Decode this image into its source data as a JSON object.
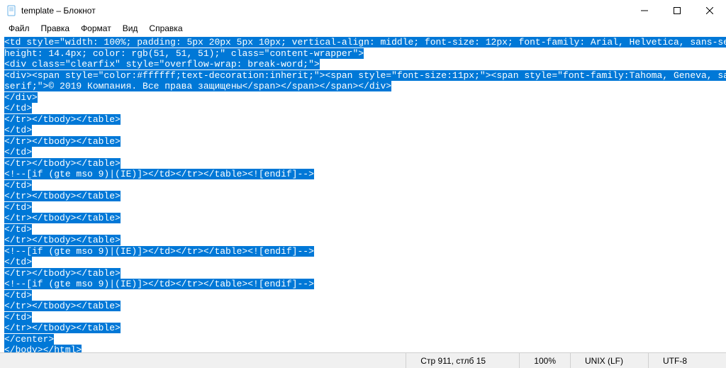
{
  "title": "template – Блокнот",
  "menu": {
    "file": "Файл",
    "edit": "Правка",
    "format": "Формат",
    "view": "Вид",
    "help": "Справка"
  },
  "content_lines": [
    "<td style=\"width: 100%; padding: 5px 20px 5px 10px; vertical-align: middle; font-size: 12px; font-family: Arial, Helvetica, sans-serif; line-",
    "height: 14.4px; color: rgb(51, 51, 51);\" class=\"content-wrapper\">",
    "<div class=\"clearfix\" style=\"overflow-wrap: break-word;\">",
    "<div><span style=\"color:#ffffff;text-decoration:inherit;\"><span style=\"font-size:11px;\"><span style=\"font-family:Tahoma, Geneva, sans-",
    "serif;\">© 2019 Компания. Все права защищены</span></span></span></div>",
    "</div>",
    "</td>",
    "</tr></tbody></table>",
    "</td>",
    "</tr></tbody></table>",
    "</td>",
    "</tr></tbody></table>",
    "<!--[if (gte mso 9)|(IE)]></td></tr></table><![endif]-->",
    "</td>",
    "</tr></tbody></table>",
    "</td>",
    "</tr></tbody></table>",
    "</td>",
    "</tr></tbody></table>",
    "<!--[if (gte mso 9)|(IE)]></td></tr></table><![endif]-->",
    "</td>",
    "</tr></tbody></table>",
    "<!--[if (gte mso 9)|(IE)]></td></tr></table><![endif]-->",
    "</td>",
    "</tr></tbody></table>",
    "</td>",
    "</tr></tbody></table>",
    "</center>",
    "</body></html>"
  ],
  "status": {
    "position": "Стр 911, стлб 15",
    "zoom": "100%",
    "line_ending": "UNIX (LF)",
    "encoding": "UTF-8"
  }
}
